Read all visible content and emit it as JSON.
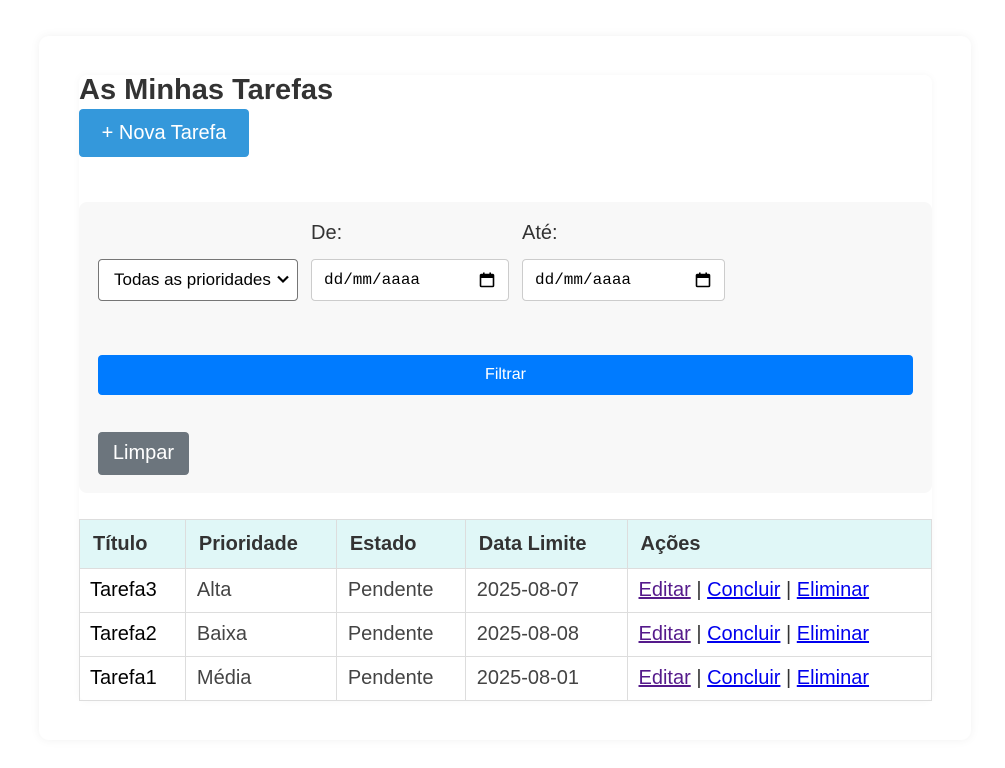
{
  "page": {
    "title": "As Minhas Tarefas",
    "new_task_label": "+ Nova Tarefa"
  },
  "filters": {
    "priority_selected": "Todas as prioridades",
    "from_label": "De:",
    "to_label": "Até:",
    "from_placeholder": "dd/mm/aaaa",
    "to_placeholder": "dd/mm/aaaa",
    "filter_button": "Filtrar",
    "clear_button": "Limpar"
  },
  "table": {
    "headers": [
      "Título",
      "Prioridade",
      "Estado",
      "Data Limite",
      "Ações"
    ],
    "rows": [
      {
        "title": "Tarefa3",
        "priority": "Alta",
        "status": "Pendente",
        "due": "2025-08-07"
      },
      {
        "title": "Tarefa2",
        "priority": "Baixa",
        "status": "Pendente",
        "due": "2025-08-08"
      },
      {
        "title": "Tarefa1",
        "priority": "Média",
        "status": "Pendente",
        "due": "2025-08-01"
      }
    ],
    "actions": {
      "edit": "Editar",
      "complete": "Concluir",
      "delete": "Eliminar",
      "separator": "|"
    }
  },
  "colors": {
    "new_button": "#3498db",
    "filter_button": "#007bff",
    "clear_button": "#6c757d",
    "table_header": "#e0f7f7"
  },
  "icons": {
    "select": "chevron-down-icon",
    "date": "calendar-icon"
  }
}
